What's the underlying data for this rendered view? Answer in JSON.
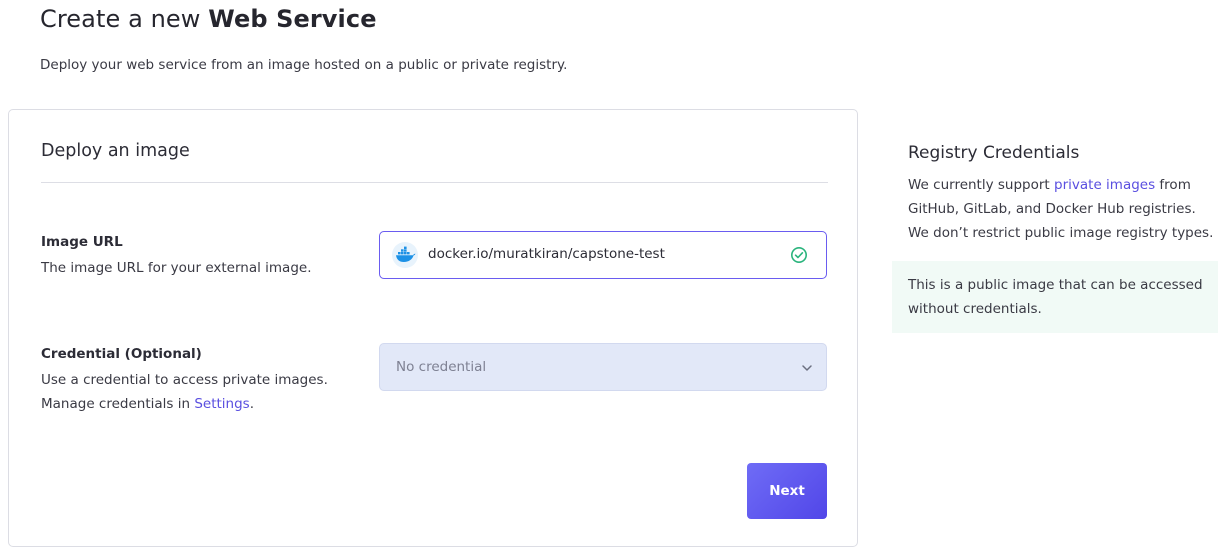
{
  "header": {
    "title_prefix": "Create a new",
    "title_strong": "Web Service",
    "subtitle": "Deploy your web service from an image hosted on a public or private registry."
  },
  "form": {
    "section_title": "Deploy an image",
    "image_url": {
      "label": "Image URL",
      "help": "The image URL for your external image.",
      "value": "docker.io/muratkiran/capstone-test",
      "icon": "docker-icon",
      "status_icon": "check-circle-icon",
      "status_color": "#2bb47d"
    },
    "credential": {
      "label": "Credential (Optional)",
      "help_line1": "Use a credential to access private images.",
      "help_line2_prefix": "Manage credentials in",
      "help_line2_link": "Settings",
      "help_line2_suffix": ".",
      "selected": "No credential"
    },
    "next_label": "Next"
  },
  "sidebar": {
    "title": "Registry Credentials",
    "line1_prefix": "We currently support",
    "line1_link": "private images",
    "line1_suffix": "from",
    "line2": "GitHub, GitLab, and Docker Hub registries.",
    "line3": "We don’t restrict public image registry types.",
    "note_line1": "This is a public image that can be accessed",
    "note_line2": "without credentials."
  },
  "colors": {
    "accent": "#5a4fe0",
    "button": "#5c54ee",
    "success": "#2bb47d",
    "note_bg": "#f1faf6"
  }
}
